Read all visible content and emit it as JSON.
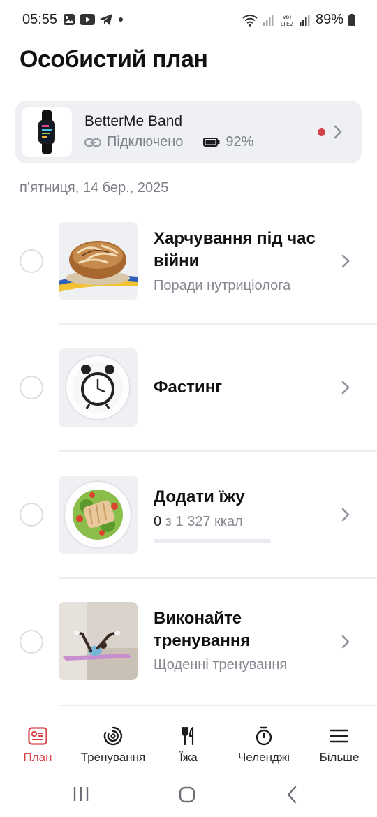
{
  "status_bar": {
    "time": "05:55",
    "battery": "89%",
    "network": "LTE2"
  },
  "page": {
    "title": "Особистий план",
    "date": "п’ятниця, 14 бер., 2025"
  },
  "device": {
    "name": "BetterMe Band",
    "status": "Підключено",
    "battery": "92%",
    "icon": "fitness-band-image"
  },
  "plan_items": [
    {
      "title": "Харчування під час війни",
      "subtitle": "Поради нутриціолога",
      "thumb": "bread-image"
    },
    {
      "title": "Фастинг",
      "thumb": "alarm-clock-plate-image"
    },
    {
      "title": "Додати їжу",
      "kcal_consumed": "0",
      "kcal_rest": " з 1 327 ккал",
      "progress": 0,
      "thumb": "salad-plate-image"
    },
    {
      "title": "Виконайте тренування",
      "subtitle": "Щоденні тренування",
      "thumb": "workout-image"
    }
  ],
  "nav": {
    "items": [
      {
        "label": "План",
        "icon": "plan-icon",
        "active": true
      },
      {
        "label": "Тренування",
        "icon": "workout-ring-icon"
      },
      {
        "label": "Їжа",
        "icon": "fork-knife-icon"
      },
      {
        "label": "Челенджі",
        "icon": "stopwatch-icon"
      },
      {
        "label": "Більше",
        "icon": "menu-icon"
      }
    ]
  },
  "colors": {
    "accent": "#d9434a",
    "card_bg": "#eef0f4",
    "muted_text": "#858891"
  }
}
